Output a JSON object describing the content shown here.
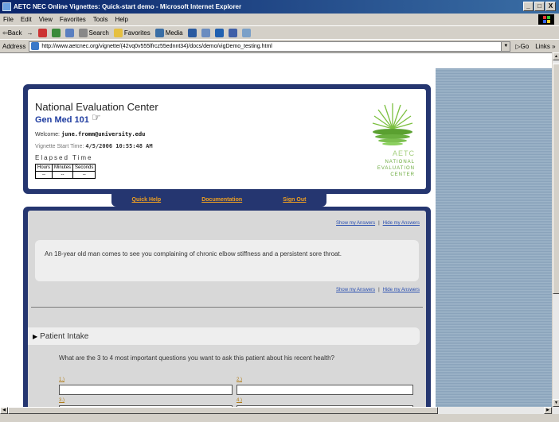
{
  "window": {
    "title": "AETC NEC Online Vignettes: Quick-start demo - Microsoft Internet Explorer",
    "controls": [
      "_",
      "□",
      "X"
    ]
  },
  "menu": [
    "File",
    "Edit",
    "View",
    "Favorites",
    "Tools",
    "Help"
  ],
  "toolbar": {
    "back": "⇦Back",
    "forward": "→",
    "search": "Search",
    "favorites": "Favorites",
    "media": "Media"
  },
  "address": {
    "label": "Address",
    "url": "http://www.aetcnec.org/vignette/(42vq0v555lfrcz55ednnt34)/docs/demo/vigDemo_testing.html",
    "go": "▷Go",
    "links": "Links »"
  },
  "header": {
    "title": "National Evaluation Center",
    "course": "Gen Med 101",
    "welcome_label": "Welcome:",
    "welcome_user": "june.fromm@university.edu",
    "start_label": "Vignette Start Time:",
    "start_value": "4/5/2006 10:55:48 AM",
    "elapsed_label": "Elapsed Time",
    "timer_headers": [
      "Hours",
      "Minutes",
      "Seconds"
    ],
    "timer_values": [
      "--",
      "--",
      "--"
    ]
  },
  "logo": {
    "line1": "AETC",
    "line2": "NATIONAL",
    "line3": "EVALUATION",
    "line4": "CENTER"
  },
  "nav": {
    "quick_help": "Quick Help",
    "documentation": "Documentation",
    "sign_out": "Sign Out"
  },
  "answers": {
    "show": "Show my Answers",
    "hide": "Hide my Answers",
    "sep": "|"
  },
  "case": {
    "text": "An 18-year old man comes to see you complaining of chronic elbow stiffness and a persistent sore throat."
  },
  "intake": {
    "title": "Patient Intake",
    "question": "What are the 3 to 4 most important questions you want to ask this patient about his recent health?",
    "labels": [
      "1.)",
      "2.)",
      "3.)",
      "4.)"
    ]
  }
}
